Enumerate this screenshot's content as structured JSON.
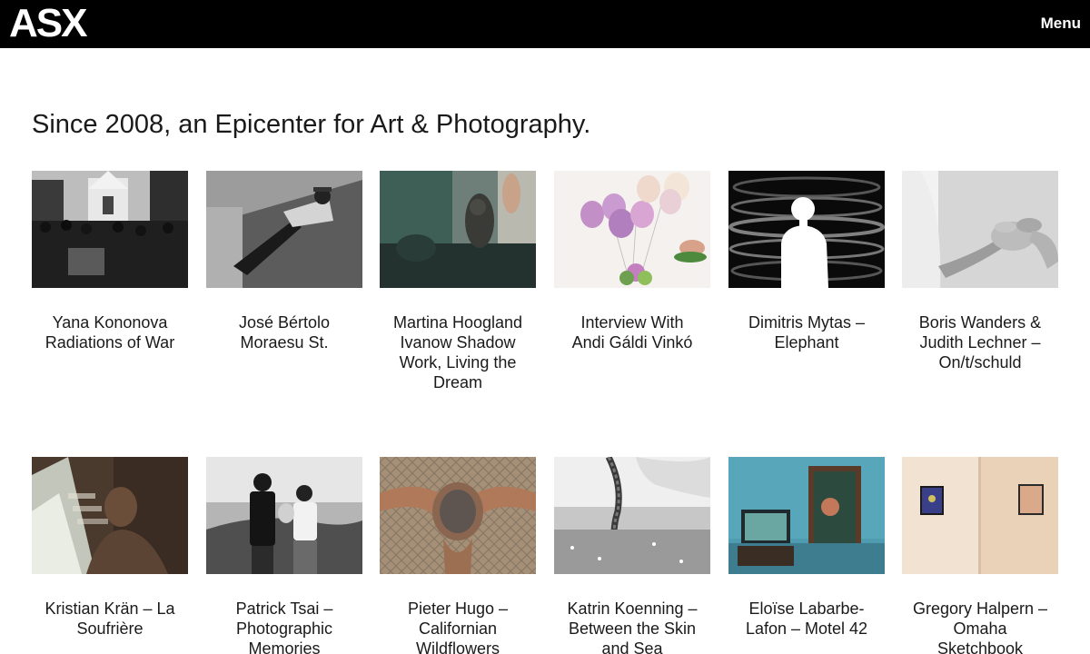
{
  "site": {
    "logo": "ASX",
    "menu_label": "Menu"
  },
  "headline": "Since 2008, an Epicenter for Art & Photography.",
  "articles": [
    {
      "title": "Yana Kononova Radiations of War",
      "thumb": "crowd-church-bw"
    },
    {
      "title": "José Bértolo Moraesu St.",
      "thumb": "man-lying-grass-bw"
    },
    {
      "title": "Martina Hoogland Ivanow Shadow Work, Living the Dream",
      "thumb": "figures-window-green"
    },
    {
      "title": "Interview With Andi Gáldi Vinkó",
      "thumb": "pink-balloons"
    },
    {
      "title": "Dimitris Mytas – Elephant",
      "thumb": "silhouette-spiral"
    },
    {
      "title": "Boris Wanders & Judith Lechner – On/t/schuld",
      "thumb": "clasped-hands"
    },
    {
      "title": "Kristian Krän – La Soufrière",
      "thumb": "portrait-light-leak"
    },
    {
      "title": "Patrick Tsai – Photographic Memories",
      "thumb": "couple-overlook-bw"
    },
    {
      "title": "Pieter Hugo – Californian Wildflowers",
      "thumb": "tattooed-head"
    },
    {
      "title": "Katrin Koenning – Between the Skin and Sea",
      "thumb": "braid-grass-bw"
    },
    {
      "title": "Eloïse Labarbe-Lafon – Motel 42",
      "thumb": "motel-room-blue"
    },
    {
      "title": "Gregory Halpern – Omaha Sketchbook",
      "thumb": "gallery-wall-frames"
    }
  ]
}
